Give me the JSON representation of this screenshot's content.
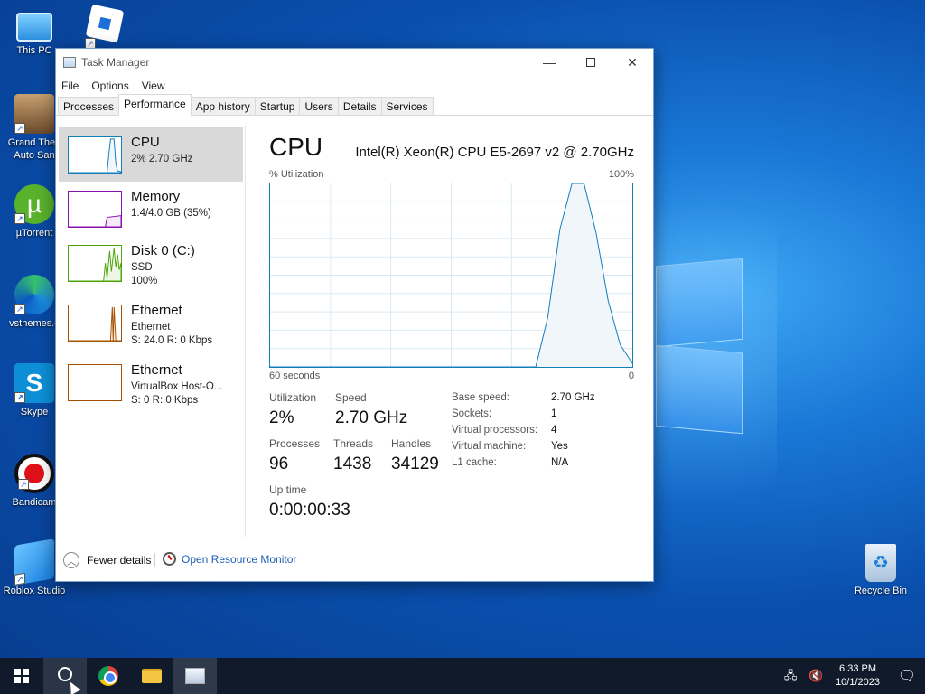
{
  "desktop": {
    "icons": [
      {
        "label": "This PC",
        "icon": "computer-icon"
      },
      {
        "label": "",
        "icon": "roblox-icon"
      },
      {
        "label": "Grand Theft Auto San",
        "icon": "gta-icon"
      },
      {
        "label": "µTorrent",
        "icon": "utorrent-icon"
      },
      {
        "label": "vsthemes.c",
        "icon": "edge-icon"
      },
      {
        "label": "Skype",
        "icon": "skype-icon"
      },
      {
        "label": "Bandicam",
        "icon": "bandicam-icon"
      },
      {
        "label": "Roblox Studio",
        "icon": "roblox-studio-icon"
      },
      {
        "label": "Recycle Bin",
        "icon": "recycle-bin-icon"
      }
    ]
  },
  "window": {
    "title": "Task Manager",
    "menu": [
      "File",
      "Options",
      "View"
    ],
    "tabs": [
      "Processes",
      "Performance",
      "App history",
      "Startup",
      "Users",
      "Details",
      "Services"
    ],
    "active_tab": "Performance"
  },
  "sidebar": {
    "items": [
      {
        "name": "CPU",
        "line1": "2% 2.70 GHz",
        "line2": "",
        "color": "#117dbb",
        "selected": true
      },
      {
        "name": "Memory",
        "line1": "1.4/4.0 GB (35%)",
        "line2": "",
        "color": "#8b12ae"
      },
      {
        "name": "Disk 0 (C:)",
        "line1": "SSD",
        "line2": "100%",
        "color": "#4da60c"
      },
      {
        "name": "Ethernet",
        "line1": "Ethernet",
        "line2": "S: 24.0 R: 0 Kbps",
        "color": "#a74f01"
      },
      {
        "name": "Ethernet",
        "line1": "VirtualBox Host-O...",
        "line2": "S: 0 R: 0 Kbps",
        "color": "#a74f01"
      }
    ]
  },
  "cpu": {
    "title": "CPU",
    "model": "Intel(R) Xeon(R) CPU E5-2697 v2 @ 2.70GHz",
    "util_label": "% Utilization",
    "util_max": "100%",
    "time_label": "60 seconds",
    "time_zero": "0",
    "stats": {
      "utilization_label": "Utilization",
      "utilization": "2%",
      "speed_label": "Speed",
      "speed": "2.70 GHz",
      "processes_label": "Processes",
      "processes": "96",
      "threads_label": "Threads",
      "threads": "1438",
      "handles_label": "Handles",
      "handles": "34129",
      "uptime_label": "Up time",
      "uptime": "0:00:00:33"
    },
    "details": [
      {
        "k": "Base speed:",
        "v": "2.70 GHz"
      },
      {
        "k": "Sockets:",
        "v": "1"
      },
      {
        "k": "Virtual processors:",
        "v": "4"
      },
      {
        "k": "Virtual machine:",
        "v": "Yes"
      },
      {
        "k": "L1 cache:",
        "v": "N/A"
      }
    ]
  },
  "footer": {
    "fewer_details": "Fewer details",
    "open_resource_monitor": "Open Resource Monitor"
  },
  "taskbar": {
    "time": "6:33 PM",
    "date": "10/1/2023"
  },
  "chart_data": {
    "type": "line",
    "x": [
      0,
      2,
      4,
      6,
      8,
      10,
      12,
      14,
      16,
      18,
      20,
      22,
      24,
      26,
      28,
      30,
      32,
      34,
      36,
      38,
      40,
      42,
      44,
      46,
      48,
      50,
      52,
      54,
      56,
      58,
      60
    ],
    "values": [
      0,
      0,
      0,
      0,
      0,
      0,
      0,
      0,
      0,
      0,
      0,
      0,
      0,
      0,
      0,
      0,
      0,
      0,
      0,
      0,
      0,
      0,
      0,
      27,
      75,
      100,
      100,
      73,
      36,
      12,
      2
    ],
    "xlim": [
      0,
      60
    ],
    "ylim": [
      0,
      100
    ],
    "grid": true,
    "color": "#117dbb"
  }
}
